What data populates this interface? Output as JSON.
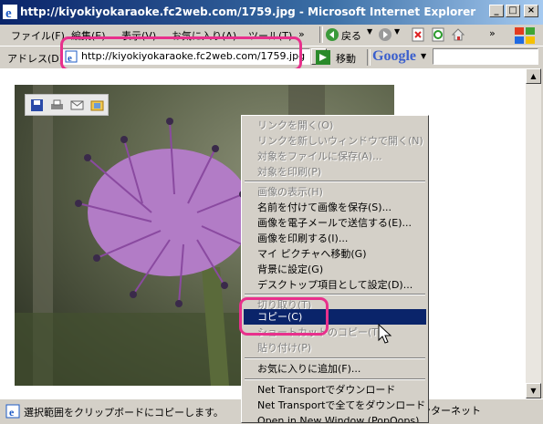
{
  "window": {
    "title": "http://kiyokiyokaraoke.fc2web.com/1759.jpg - Microsoft Internet Explorer"
  },
  "menu": [
    "ファイル(F)",
    "編集(E)",
    "表示(V)",
    "お気に入り(A)",
    "ツール(T)"
  ],
  "toolbar": {
    "back_label": "戻る"
  },
  "address": {
    "label": "アドレス(D)",
    "url": "http://kiyokiyokaraoke.fc2web.com/1759.jpg",
    "go_label": "移動",
    "google_label": "Google"
  },
  "context_menu": [
    {
      "label": "リンクを開く(O)",
      "enabled": false
    },
    {
      "label": "リンクを新しいウィンドウで開く(N)",
      "enabled": false
    },
    {
      "label": "対象をファイルに保存(A)...",
      "enabled": false
    },
    {
      "label": "対象を印刷(P)",
      "enabled": false
    },
    {
      "label": "画像の表示(H)",
      "enabled": false
    },
    {
      "label": "名前を付けて画像を保存(S)...",
      "enabled": true
    },
    {
      "label": "画像を電子メールで送信する(E)...",
      "enabled": true
    },
    {
      "label": "画像を印刷する(I)...",
      "enabled": true
    },
    {
      "label": "マイ ピクチャへ移動(G)",
      "enabled": true
    },
    {
      "label": "背景に設定(G)",
      "enabled": true
    },
    {
      "label": "デスクトップ項目として設定(D)...",
      "enabled": true
    },
    {
      "label": "切り取り(T)",
      "enabled": false
    },
    {
      "label": "コピー(C)",
      "enabled": true,
      "selected": true
    },
    {
      "label": "ショートカットのコピー(T)",
      "enabled": false
    },
    {
      "label": "貼り付け(P)",
      "enabled": false
    },
    {
      "label": "お気に入りに追加(F)...",
      "enabled": true
    },
    {
      "label": "Net Transportでダウンロード",
      "enabled": true
    },
    {
      "label": "Net Transportで全てをダウンロード",
      "enabled": true
    },
    {
      "label": "Open in New Window (PopOops)",
      "enabled": true
    }
  ],
  "status": {
    "text": "選択範囲をクリップボードにコピーします。",
    "zone": "インターネット"
  },
  "colors": {
    "highlight_ring": "#e8308c",
    "selection": "#0a246a",
    "title_bar": "#0a246a"
  }
}
